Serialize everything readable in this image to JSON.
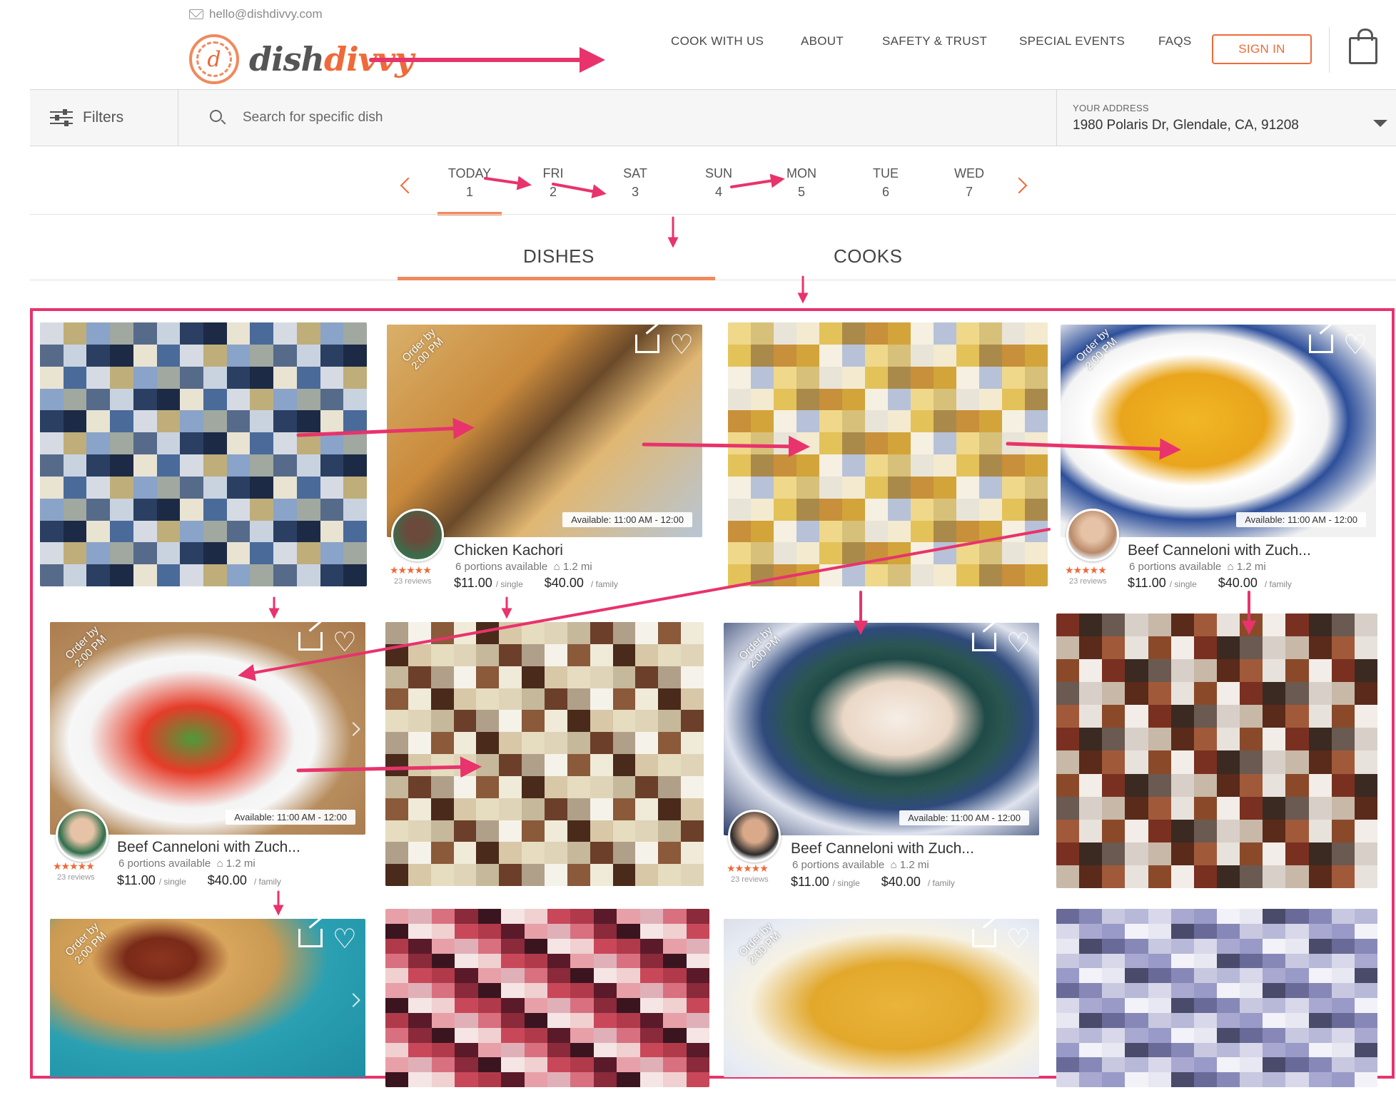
{
  "header": {
    "email": "hello@dishdivvy.com",
    "logo_mark": "d",
    "logo_part1": "dish",
    "logo_part2": "divvy",
    "nav": [
      "COOK WITH US",
      "ABOUT",
      "SAFETY & TRUST",
      "SPECIAL EVENTS",
      "FAQS"
    ],
    "signin_label": "SIGN IN"
  },
  "search": {
    "filters_label": "Filters",
    "placeholder": "Search for specific dish",
    "address_label": "YOUR ADDRESS",
    "address_value": "1980 Polaris Dr, Glendale, CA, 91208"
  },
  "days": [
    {
      "name": "TODAY",
      "num": "1"
    },
    {
      "name": "FRI",
      "num": "2"
    },
    {
      "name": "SAT",
      "num": "3"
    },
    {
      "name": "SUN",
      "num": "4"
    },
    {
      "name": "MON",
      "num": "5"
    },
    {
      "name": "TUE",
      "num": "6"
    },
    {
      "name": "WED",
      "num": "7"
    }
  ],
  "tabs": {
    "dishes": "DISHES",
    "cooks": "COOKS"
  },
  "cards": [
    {
      "order_by": "Order by\n2:00 PM",
      "available": "Available: 11:00 AM - 12:00",
      "name": "Chicken Kachori",
      "portions": "6 portions available",
      "distance": "1.2 mi",
      "stars": "★★★★★",
      "reviews": "23 reviews",
      "price_single": "$11.00",
      "single_label": "/ single",
      "price_family": "$40.00",
      "family_label": "/ family"
    },
    {
      "order_by": "Order by\n2:00 PM",
      "available": "Available: 11:00 AM - 12:00",
      "name": "Beef Canneloni with Zuch...",
      "portions": "6 portions available",
      "distance": "1.2 mi",
      "stars": "★★★★★",
      "reviews": "23 reviews",
      "price_single": "$11.00",
      "single_label": "/ single",
      "price_family": "$40.00",
      "family_label": "/ family"
    },
    {
      "order_by": "Order by\n2:00 PM",
      "available": "Available: 11:00 AM - 12:00",
      "name": "Beef Canneloni with Zuch...",
      "portions": "6 portions available",
      "distance": "1.2 mi",
      "stars": "★★★★★",
      "reviews": "23 reviews",
      "price_single": "$11.00",
      "single_label": "/ single",
      "price_family": "$40.00",
      "family_label": "/ family"
    },
    {
      "order_by": "Order by\n2:00 PM",
      "available": "Available: 11:00 AM - 12:00",
      "name": "Beef Canneloni with Zuch...",
      "portions": "6 portions available",
      "distance": "1.2 mi",
      "stars": "★★★★★",
      "reviews": "23 reviews",
      "price_single": "$11.00",
      "single_label": "/ single",
      "price_family": "$40.00",
      "family_label": "/ family"
    },
    {
      "order_by": "Order by\n2:00 PM"
    },
    {
      "order_by": "Order by\n2:00 PM"
    }
  ],
  "colors": {
    "accent": "#ef6a3a",
    "annotation": "#e8336c"
  },
  "icons": [
    "mail-icon",
    "filter-icon",
    "search-icon",
    "chevron-down-icon",
    "shopping-bag-icon",
    "share-icon",
    "heart-icon"
  ]
}
